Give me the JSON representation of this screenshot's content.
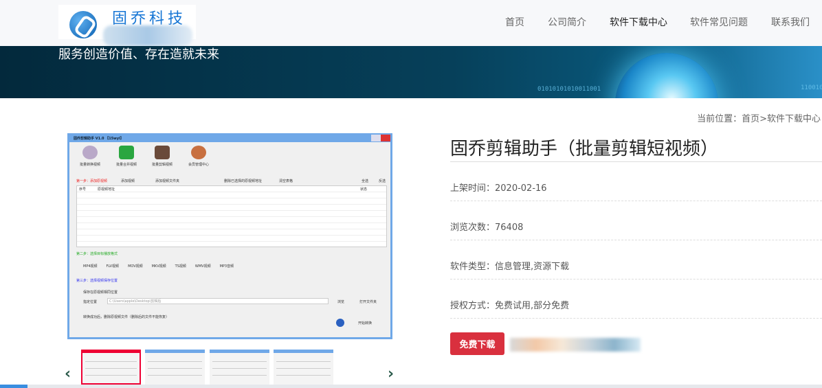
{
  "header": {
    "logo_text": "固乔科技",
    "nav": [
      "首页",
      "公司简介",
      "软件下载中心",
      "软件常见问题",
      "联系我们"
    ],
    "active_nav": "软件下载中心"
  },
  "banner": {
    "slogan": "服务创造价值、存在造就未来",
    "binary_1": "01010101010011001",
    "binary_2": "110010"
  },
  "breadcrumb": "当前位置：首页>软件下载中心",
  "screenshot": {
    "window_title": "固乔剪辑助手 V1.0 【15wyl】",
    "tools": [
      "批量转换视频",
      "批量合并视频",
      "批量剪辑视频",
      "会员管理中心"
    ],
    "step1": "第一步：添加原视频",
    "add_video": "添加视频",
    "add_folder": "添加视频文件夹",
    "delete_selected": "删除已选择的原视频地址",
    "clear_table": "清空表格",
    "select_all": "全选",
    "invert": "反选",
    "columns": [
      "序号",
      "原视频地址",
      "状态"
    ],
    "step2": "第二步：选择目标播放格式",
    "formats": [
      "MP4视频",
      "FLV视频",
      "MOV视频",
      "MKV视频",
      "TS视频",
      "WMV视频",
      "MP3音频"
    ],
    "step3": "第三步：选择视频保存位置",
    "same_location": "保存在原视频相同位置",
    "custom_location": "指定位置",
    "path": "C:\\Users\\apple\\Desktop\\剪辑后",
    "browse": "浏览",
    "open_folder": "打开文件夹",
    "delete_after": "转换成功后，删除原视频文件（删除后的文件不能恢复）",
    "start": "开始转换"
  },
  "product": {
    "title": "固乔剪辑助手（批量剪辑短视频）",
    "rows": [
      {
        "label": "上架时间：",
        "value": "2020-02-16"
      },
      {
        "label": "浏览次数：",
        "value": "76408"
      },
      {
        "label": "软件类型：",
        "value": "信息管理,资源下载"
      },
      {
        "label": "授权方式：",
        "value": "免费试用,部分免费"
      }
    ],
    "download_label": "免费下载"
  },
  "colors": {
    "download": "#d9303e",
    "nav_active": "#222222",
    "banner": "#06405a"
  }
}
